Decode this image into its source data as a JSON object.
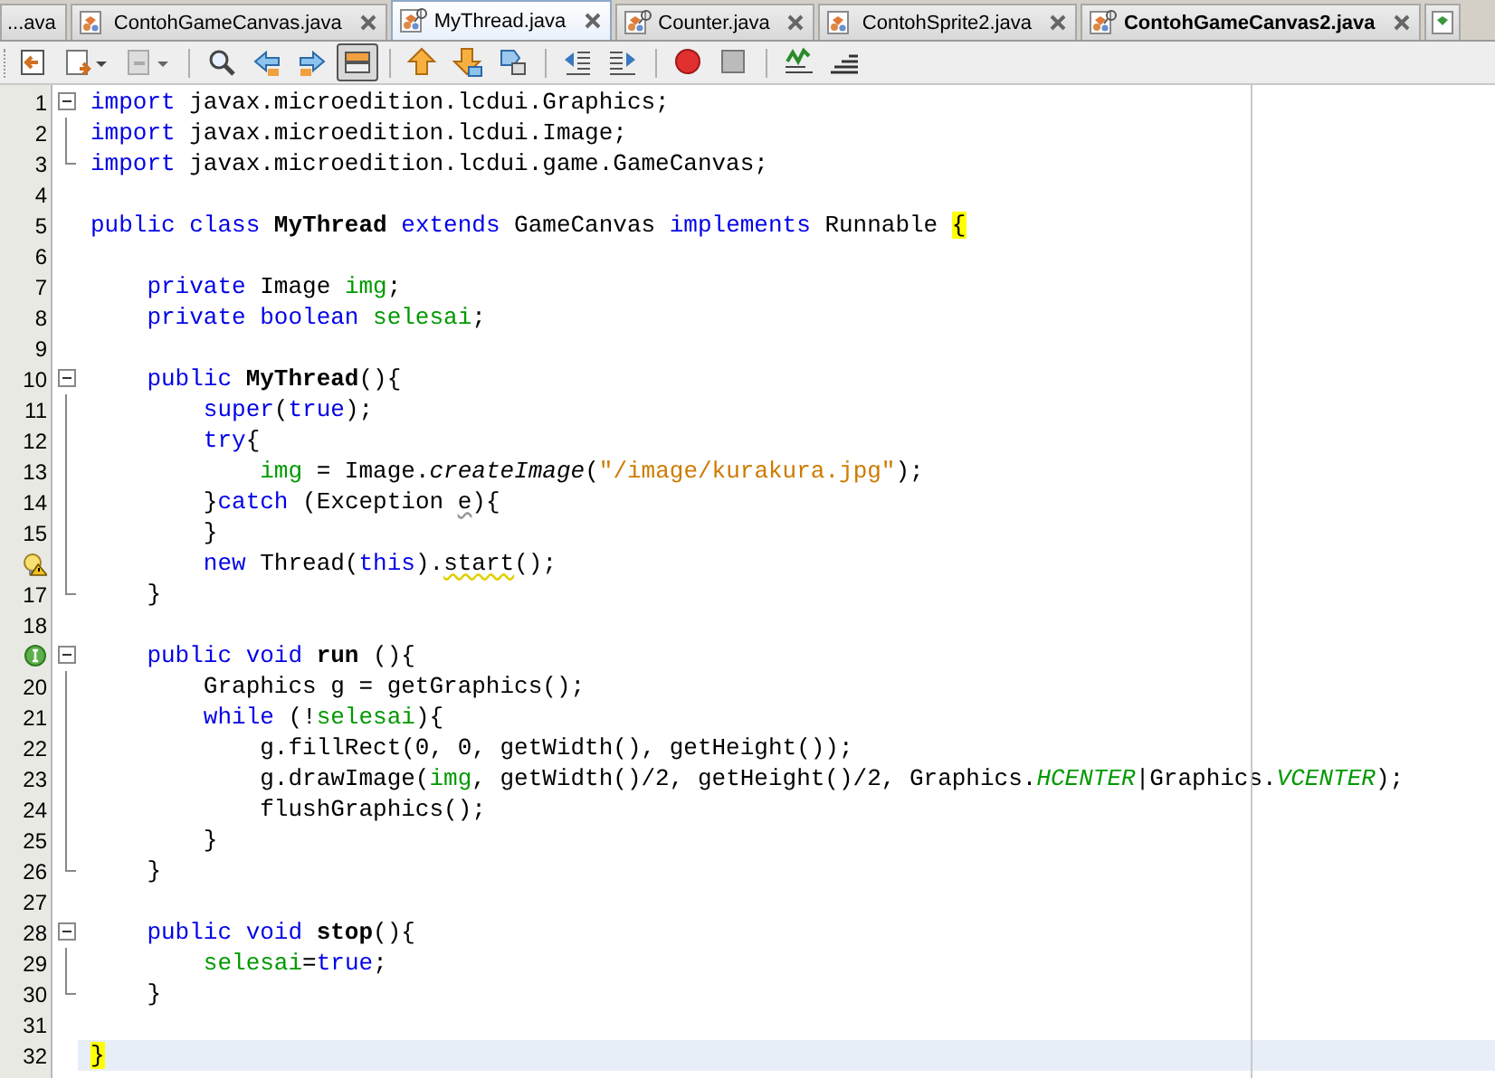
{
  "tabs": [
    {
      "label": "...ava",
      "selected": false,
      "icon": false,
      "modified": false
    },
    {
      "label": "ContohGameCanvas.java",
      "selected": false,
      "icon": true,
      "modified": false,
      "badge": false
    },
    {
      "label": "MyThread.java",
      "selected": true,
      "icon": true,
      "modified": false,
      "badge": true
    },
    {
      "label": "Counter.java",
      "selected": false,
      "icon": true,
      "modified": false,
      "badge": true
    },
    {
      "label": "ContohSprite2.java",
      "selected": false,
      "icon": true,
      "modified": false,
      "badge": false
    },
    {
      "label": "ContohGameCanvas2.java",
      "selected": false,
      "icon": true,
      "modified": true,
      "badge": true
    }
  ],
  "toolbar": [
    {
      "kind": "back",
      "pressed": false
    },
    {
      "kind": "doc-menu",
      "pressed": false
    },
    {
      "kind": "doc-menu-disabled",
      "pressed": false
    },
    {
      "kind": "separator"
    },
    {
      "kind": "find",
      "pressed": false
    },
    {
      "kind": "prev",
      "pressed": false
    },
    {
      "kind": "next",
      "pressed": false
    },
    {
      "kind": "toggle",
      "pressed": true
    },
    {
      "kind": "separator"
    },
    {
      "kind": "up",
      "pressed": false
    },
    {
      "kind": "down",
      "pressed": false
    },
    {
      "kind": "shapes",
      "pressed": false
    },
    {
      "kind": "separator"
    },
    {
      "kind": "shift-left",
      "pressed": false
    },
    {
      "kind": "shift-right",
      "pressed": false
    },
    {
      "kind": "separator"
    },
    {
      "kind": "record",
      "pressed": false
    },
    {
      "kind": "stop",
      "pressed": false
    },
    {
      "kind": "separator"
    },
    {
      "kind": "check",
      "pressed": false
    },
    {
      "kind": "bars",
      "pressed": false
    }
  ],
  "editor": {
    "lines": [
      {
        "number": "1",
        "hint": false,
        "implements": false,
        "fold_toggle": true,
        "fold_line": false,
        "fold_end": false,
        "current": false,
        "tokens": [
          {
            "kind": "keyword",
            "text": "import"
          },
          {
            "kind": "plain",
            "text": " javax.microedition.lcdui.Graphics;"
          }
        ]
      },
      {
        "number": "2",
        "hint": false,
        "implements": false,
        "fold_toggle": false,
        "fold_line": true,
        "fold_end": false,
        "current": false,
        "tokens": [
          {
            "kind": "keyword",
            "text": "import"
          },
          {
            "kind": "plain",
            "text": " javax.microedition.lcdui.Image;"
          }
        ]
      },
      {
        "number": "3",
        "hint": false,
        "implements": false,
        "fold_toggle": false,
        "fold_line": false,
        "fold_end": true,
        "current": false,
        "tokens": [
          {
            "kind": "keyword",
            "text": "import"
          },
          {
            "kind": "plain",
            "text": " javax.microedition.lcdui.game.GameCanvas;"
          }
        ]
      },
      {
        "number": "4",
        "hint": false,
        "implements": false,
        "fold_toggle": false,
        "fold_line": false,
        "fold_end": false,
        "current": false
      },
      {
        "number": "5",
        "hint": false,
        "implements": false,
        "fold_toggle": false,
        "fold_line": false,
        "fold_end": false,
        "current": false,
        "tokens": [
          {
            "kind": "keyword",
            "text": "public class"
          },
          {
            "kind": "name",
            "text": " MyThread "
          },
          {
            "kind": "keyword",
            "text": "extends"
          },
          {
            "kind": "plain",
            "text": " GameCanvas "
          },
          {
            "kind": "keyword",
            "text": "implements"
          },
          {
            "kind": "plain",
            "text": " Runnable "
          },
          {
            "kind": "match",
            "text": "{"
          }
        ]
      },
      {
        "number": "6",
        "hint": false,
        "implements": false,
        "fold_toggle": false,
        "fold_line": false,
        "fold_end": false,
        "current": false
      },
      {
        "number": "7",
        "hint": false,
        "implements": false,
        "fold_toggle": false,
        "fold_line": false,
        "fold_end": false,
        "current": false,
        "tokens": [
          {
            "kind": "keyword",
            "text": "    private"
          },
          {
            "kind": "plain",
            "text": " Image "
          },
          {
            "kind": "field",
            "text": "img"
          },
          {
            "kind": "plain",
            "text": ";"
          }
        ]
      },
      {
        "number": "8",
        "hint": false,
        "implements": false,
        "fold_toggle": false,
        "fold_line": false,
        "fold_end": false,
        "current": false,
        "tokens": [
          {
            "kind": "keyword",
            "text": "    private boolean "
          },
          {
            "kind": "field",
            "text": "selesai"
          },
          {
            "kind": "plain",
            "text": ";"
          }
        ]
      },
      {
        "number": "9",
        "hint": false,
        "implements": false,
        "fold_toggle": false,
        "fold_line": false,
        "fold_end": false,
        "current": false
      },
      {
        "number": "10",
        "hint": false,
        "implements": false,
        "fold_toggle": true,
        "fold_line": false,
        "fold_end": false,
        "current": false,
        "tokens": [
          {
            "kind": "keyword",
            "text": "    public"
          },
          {
            "kind": "name",
            "text": " MyThread"
          },
          {
            "kind": "plain",
            "text": "(){"
          }
        ]
      },
      {
        "number": "11",
        "hint": false,
        "implements": false,
        "fold_toggle": false,
        "fold_line": true,
        "fold_end": false,
        "current": false,
        "tokens": [
          {
            "kind": "keyword",
            "text": "        super"
          },
          {
            "kind": "plain",
            "text": "("
          },
          {
            "kind": "keyword",
            "text": "true"
          },
          {
            "kind": "plain",
            "text": ");"
          }
        ]
      },
      {
        "number": "12",
        "hint": false,
        "implements": false,
        "fold_toggle": false,
        "fold_line": true,
        "fold_end": false,
        "current": false,
        "tokens": [
          {
            "kind": "keyword",
            "text": "        try"
          },
          {
            "kind": "plain",
            "text": "{"
          }
        ]
      },
      {
        "number": "13",
        "hint": false,
        "implements": false,
        "fold_toggle": false,
        "fold_line": true,
        "fold_end": false,
        "current": false,
        "tokens": [
          {
            "kind": "field",
            "text": "            img"
          },
          {
            "kind": "plain",
            "text": " = Image."
          },
          {
            "kind": "italic",
            "text": "createImage"
          },
          {
            "kind": "plain",
            "text": "("
          },
          {
            "kind": "string",
            "text": "\"/image/kurakura.jpg\""
          },
          {
            "kind": "plain",
            "text": ");"
          }
        ]
      },
      {
        "number": "14",
        "hint": false,
        "implements": false,
        "fold_toggle": false,
        "fold_line": true,
        "fold_end": false,
        "current": false,
        "tokens": [
          {
            "kind": "plain",
            "text": "        }"
          },
          {
            "kind": "keyword",
            "text": "catch"
          },
          {
            "kind": "plain",
            "text": " (Exception "
          },
          {
            "kind": "unused",
            "text": "e"
          },
          {
            "kind": "plain",
            "text": "){"
          }
        ]
      },
      {
        "number": "15",
        "hint": false,
        "implements": false,
        "fold_toggle": false,
        "fold_line": true,
        "fold_end": false,
        "current": false,
        "tokens": [
          {
            "kind": "plain",
            "text": "        }"
          }
        ]
      },
      {
        "hint": true,
        "implements": false,
        "fold_toggle": false,
        "fold_line": true,
        "fold_end": false,
        "current": false,
        "tokens": [
          {
            "kind": "keyword",
            "text": "        new"
          },
          {
            "kind": "plain",
            "text": " Thread("
          },
          {
            "kind": "keyword",
            "text": "this"
          },
          {
            "kind": "plain",
            "text": ")."
          },
          {
            "kind": "warning",
            "text": "start"
          },
          {
            "kind": "plain",
            "text": "();"
          }
        ]
      },
      {
        "number": "17",
        "hint": false,
        "implements": false,
        "fold_toggle": false,
        "fold_line": false,
        "fold_end": true,
        "current": false,
        "tokens": [
          {
            "kind": "plain",
            "text": "    }"
          }
        ]
      },
      {
        "number": "18",
        "hint": false,
        "implements": false,
        "fold_toggle": false,
        "fold_line": false,
        "fold_end": false,
        "current": false
      },
      {
        "hint": false,
        "implements": true,
        "fold_toggle": true,
        "fold_line": false,
        "fold_end": false,
        "current": false,
        "tokens": [
          {
            "kind": "keyword",
            "text": "    public void"
          },
          {
            "kind": "name",
            "text": " run"
          },
          {
            "kind": "plain",
            "text": " (){"
          }
        ]
      },
      {
        "number": "20",
        "hint": false,
        "implements": false,
        "fold_toggle": false,
        "fold_line": true,
        "fold_end": false,
        "current": false,
        "tokens": [
          {
            "kind": "plain",
            "text": "        Graphics g = getGraphics();"
          }
        ]
      },
      {
        "number": "21",
        "hint": false,
        "implements": false,
        "fold_toggle": false,
        "fold_line": true,
        "fold_end": false,
        "current": false,
        "tokens": [
          {
            "kind": "keyword",
            "text": "        while"
          },
          {
            "kind": "plain",
            "text": " (!"
          },
          {
            "kind": "field",
            "text": "selesai"
          },
          {
            "kind": "plain",
            "text": "){"
          }
        ]
      },
      {
        "number": "22",
        "hint": false,
        "implements": false,
        "fold_toggle": false,
        "fold_line": true,
        "fold_end": false,
        "current": false,
        "tokens": [
          {
            "kind": "plain",
            "text": "            g.fillRect(0, 0, getWidth(), getHeight());"
          }
        ]
      },
      {
        "number": "23",
        "hint": false,
        "implements": false,
        "fold_toggle": false,
        "fold_line": true,
        "fold_end": false,
        "current": false,
        "tokens": [
          {
            "kind": "plain",
            "text": "            g.drawImage("
          },
          {
            "kind": "field",
            "text": "img"
          },
          {
            "kind": "plain",
            "text": ", getWidth()/2, getHeight()/2, Graphics."
          },
          {
            "kind": "constant",
            "text": "HCENTER"
          },
          {
            "kind": "plain",
            "text": "|Graphics."
          },
          {
            "kind": "constant",
            "text": "VCENTER"
          },
          {
            "kind": "plain",
            "text": ");"
          }
        ]
      },
      {
        "number": "24",
        "hint": false,
        "implements": false,
        "fold_toggle": false,
        "fold_line": true,
        "fold_end": false,
        "current": false,
        "tokens": [
          {
            "kind": "plain",
            "text": "            flushGraphics();"
          }
        ]
      },
      {
        "number": "25",
        "hint": false,
        "implements": false,
        "fold_toggle": false,
        "fold_line": true,
        "fold_end": false,
        "current": false,
        "tokens": [
          {
            "kind": "plain",
            "text": "        }"
          }
        ]
      },
      {
        "number": "26",
        "hint": false,
        "implements": false,
        "fold_toggle": false,
        "fold_line": false,
        "fold_end": true,
        "current": false,
        "tokens": [
          {
            "kind": "plain",
            "text": "    }"
          }
        ]
      },
      {
        "number": "27",
        "hint": false,
        "implements": false,
        "fold_toggle": false,
        "fold_line": false,
        "fold_end": false,
        "current": false
      },
      {
        "number": "28",
        "hint": false,
        "implements": false,
        "fold_toggle": true,
        "fold_line": false,
        "fold_end": false,
        "current": false,
        "tokens": [
          {
            "kind": "keyword",
            "text": "    public void"
          },
          {
            "kind": "name",
            "text": " stop"
          },
          {
            "kind": "plain",
            "text": "(){"
          }
        ]
      },
      {
        "number": "29",
        "hint": false,
        "implements": false,
        "fold_toggle": false,
        "fold_line": true,
        "fold_end": false,
        "current": false,
        "tokens": [
          {
            "kind": "field",
            "text": "        selesai"
          },
          {
            "kind": "plain",
            "text": "="
          },
          {
            "kind": "keyword",
            "text": "true"
          },
          {
            "kind": "plain",
            "text": ";"
          }
        ]
      },
      {
        "number": "30",
        "hint": false,
        "implements": false,
        "fold_toggle": false,
        "fold_line": false,
        "fold_end": true,
        "current": false,
        "tokens": [
          {
            "kind": "plain",
            "text": "    }"
          }
        ]
      },
      {
        "number": "31",
        "hint": false,
        "implements": false,
        "fold_toggle": false,
        "fold_line": false,
        "fold_end": false,
        "current": false
      },
      {
        "number": "32",
        "hint": false,
        "implements": false,
        "fold_toggle": false,
        "fold_line": false,
        "fold_end": false,
        "current": true,
        "tokens": [
          {
            "kind": "match",
            "text": "}"
          }
        ]
      }
    ]
  }
}
